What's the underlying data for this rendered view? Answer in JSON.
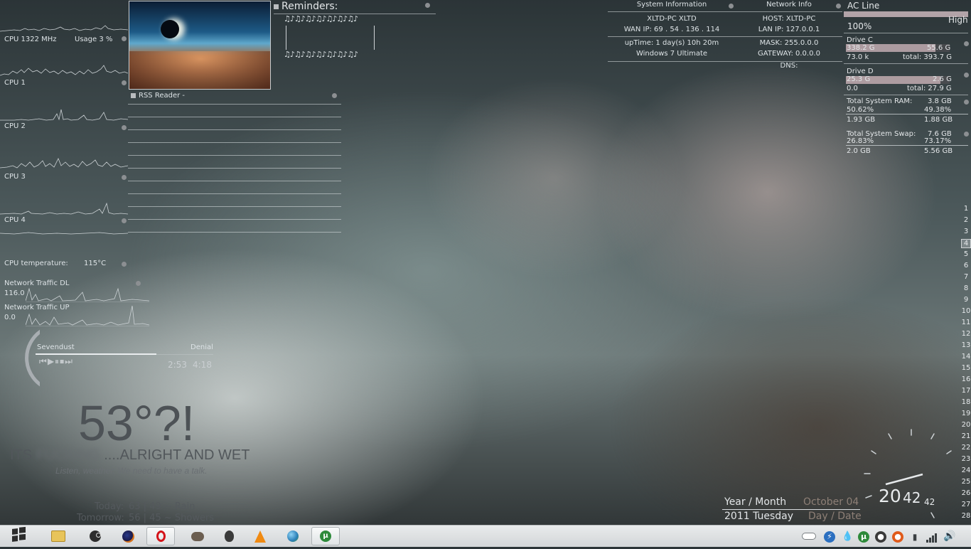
{
  "cpu": {
    "summary_freq": "CPU 1322 MHz",
    "summary_usage": "Usage 3 %",
    "cores": [
      "CPU 1",
      "CPU 2",
      "CPU 3",
      "CPU 4"
    ],
    "temp_label": "CPU temperature:",
    "temp_value": "115°C"
  },
  "network_traffic": {
    "dl_label": "Network Traffic DL",
    "dl_value": "116.0",
    "up_label": "Network Traffic UP",
    "up_value": "0.0"
  },
  "photo": {
    "alt_icon": "eclipse-over-clouds-image"
  },
  "rss": {
    "title": "RSS Reader -"
  },
  "reminders": {
    "title": "Reminders:",
    "notes": "♫♪♫♪♫♪♫♪♫♪♫♪♫♪"
  },
  "media": {
    "artist": "Sevendust",
    "track": "Denial",
    "position": "2:53",
    "length": "4:18",
    "progress": 0.68
  },
  "weather": {
    "temp": "53°?!",
    "headline_a": "ITS",
    "headline_blur": "FUCKING",
    "headline_b": "....ALRIGHT AND WET",
    "tagline": "Listen, weather. We need to have a talk.",
    "today_label": "Today:",
    "today_value": "63 | 49 ~ Rain",
    "tomorrow_label": "Tomorrow:",
    "tomorrow_value": "56 | 45 ~ Showers"
  },
  "sysinfo": {
    "title": "System Information",
    "host_line": "XLTD-PC  XLTD",
    "wan_ip": "WAN IP: 69 . 54 . 136 . 114",
    "uptime": "upTime: 1 day(s) 10h 20m",
    "os": "Windows 7 Ultimate"
  },
  "netinfo": {
    "title": "Network Info",
    "host": "HOST: XLTD-PC",
    "lan_ip": "LAN IP: 127.0.0.1",
    "mask": "MASK: 255.0.0.0",
    "gateway": "GATEWAY: 0.0.0.0",
    "dns": "DNS:"
  },
  "power": {
    "title": "AC Line",
    "level_word": "High",
    "percent": "100%",
    "fill": 1.0
  },
  "drives": [
    {
      "name": "Drive C",
      "used": "338.2 G",
      "free": "55.6 G",
      "io": "73.0 k",
      "total": "total: 393.7 G",
      "fill": 0.86
    },
    {
      "name": "Drive D",
      "used": "25.3 G",
      "free": "2.6 G",
      "io": "0.0",
      "total": "total: 27.9 G",
      "fill": 0.91
    }
  ],
  "ram": {
    "label": "Total System RAM:",
    "total": "3.8 GB",
    "pct_used": "50.62%",
    "pct_free": "49.38%",
    "used": "1.93 GB",
    "free": "1.88 GB"
  },
  "swap": {
    "label": "Total System Swap:",
    "total": "7.6 GB",
    "pct_used": "26.83%",
    "pct_free": "73.17%",
    "used": "2.0 GB",
    "free": "5.56 GB"
  },
  "calendar": {
    "days": [
      "1",
      "2",
      "3",
      "4",
      "5",
      "6",
      "7",
      "8",
      "9",
      "10",
      "11",
      "12",
      "13",
      "14",
      "15",
      "16",
      "17",
      "18",
      "19",
      "20",
      "21",
      "22",
      "23",
      "24",
      "25",
      "26",
      "27",
      "28"
    ],
    "today": "4"
  },
  "datetime": {
    "year_month_label": "Year / Month",
    "month_day": "October 04",
    "year_weekday": "2011 Tuesday",
    "day_date_label": "Day / Date",
    "hour": "20",
    "minute": "42",
    "second": "42"
  },
  "taskbar": {
    "start_icon": "windows-start-orb",
    "apps": [
      "explorer-icon",
      "steam-icon",
      "firefox-icon",
      "opera-icon",
      "gimp-icon",
      "alienware-icon",
      "vlc-icon",
      "network-globe-icon",
      "utorrent-icon"
    ],
    "active_app": "opera-icon"
  }
}
